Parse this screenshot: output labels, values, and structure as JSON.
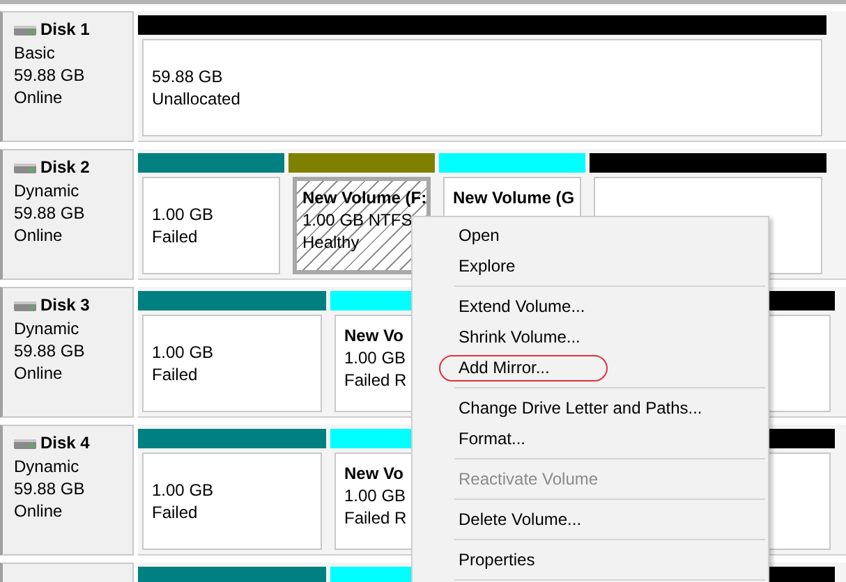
{
  "disks": [
    {
      "name": "Disk 1",
      "type": "Basic",
      "size": "59.88 GB",
      "status": "Online",
      "partitions": [
        {
          "color": "#000000",
          "selected": false,
          "lines": [
            "59.88 GB",
            "Unallocated"
          ]
        }
      ]
    },
    {
      "name": "Disk 2",
      "type": "Dynamic",
      "size": "59.88 GB",
      "status": "Online",
      "partitions": [
        {
          "color": "#008080",
          "selected": false,
          "lines": [
            "1.00 GB",
            "Failed"
          ]
        },
        {
          "color": "#808000",
          "selected": true,
          "title": "New Volume  (F:",
          "lines": [
            "1.00 GB NTFS",
            "Healthy"
          ]
        },
        {
          "color": "#00ffff",
          "selected": false,
          "title": "New Volume  (G"
        },
        {
          "color": "#000000",
          "selected": false
        }
      ]
    },
    {
      "name": "Disk 3",
      "type": "Dynamic",
      "size": "59.88 GB",
      "status": "Online",
      "partitions": [
        {
          "color": "#008080",
          "selected": false,
          "lines": [
            "1.00 GB",
            "Failed"
          ]
        },
        {
          "color": "#00ffff",
          "selected": false,
          "title": "New Vo",
          "lines": [
            "1.00 GB",
            "Failed R"
          ]
        },
        {
          "color": "#000000",
          "selected": false
        }
      ]
    },
    {
      "name": "Disk 4",
      "type": "Dynamic",
      "size": "59.88 GB",
      "status": "Online",
      "partitions": [
        {
          "color": "#008080",
          "selected": false,
          "lines": [
            "1.00 GB",
            "Failed"
          ]
        },
        {
          "color": "#00ffff",
          "selected": false,
          "title": "New Vo",
          "lines": [
            "1.00 GB",
            "Failed R"
          ]
        },
        {
          "color": "#000000",
          "selected": false
        }
      ]
    },
    {
      "partitions": [
        {
          "color": "#008080"
        },
        {
          "color": "#00ffff"
        },
        {
          "color": "#000000"
        }
      ]
    }
  ],
  "context_menu": {
    "items": [
      {
        "kind": "item",
        "label": "Open",
        "disabled": false,
        "circled": false
      },
      {
        "kind": "item",
        "label": "Explore",
        "disabled": false,
        "circled": false
      },
      {
        "kind": "separator"
      },
      {
        "kind": "item",
        "label": "Extend Volume...",
        "disabled": false,
        "circled": false
      },
      {
        "kind": "item",
        "label": "Shrink Volume...",
        "disabled": false,
        "circled": false
      },
      {
        "kind": "item",
        "label": "Add Mirror...",
        "disabled": false,
        "circled": true
      },
      {
        "kind": "separator"
      },
      {
        "kind": "item",
        "label": "Change Drive Letter and Paths...",
        "disabled": false,
        "circled": false
      },
      {
        "kind": "item",
        "label": "Format...",
        "disabled": false,
        "circled": false
      },
      {
        "kind": "separator"
      },
      {
        "kind": "item",
        "label": "Reactivate Volume",
        "disabled": true,
        "circled": false
      },
      {
        "kind": "separator"
      },
      {
        "kind": "item",
        "label": "Delete Volume...",
        "disabled": false,
        "circled": false
      },
      {
        "kind": "separator"
      },
      {
        "kind": "item",
        "label": "Properties",
        "disabled": false,
        "circled": false
      },
      {
        "kind": "separator"
      }
    ]
  }
}
